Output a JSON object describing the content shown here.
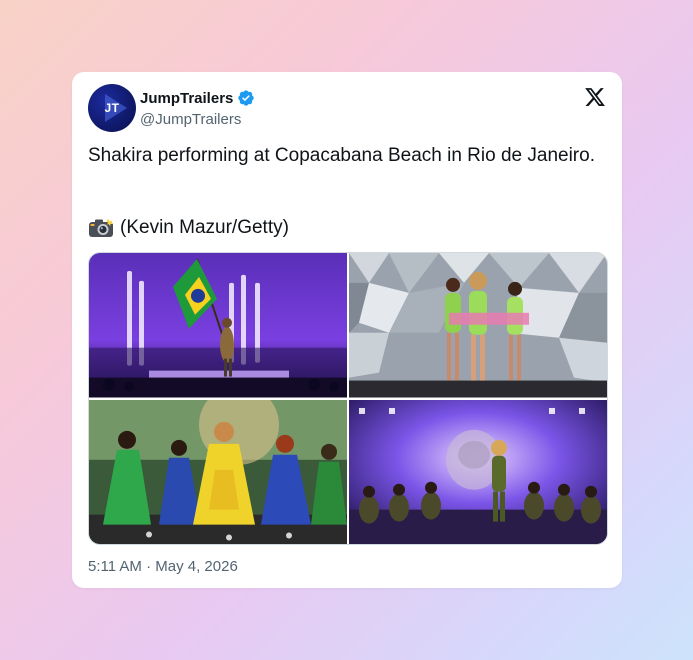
{
  "author": {
    "initials": "JT",
    "name": "JumpTrailers",
    "handle": "@JumpTrailers",
    "verified": true,
    "verified_color": "#1d9bf0"
  },
  "post": {
    "text": "Shakira performing at Copacabana Beach in Rio de Janeiro.",
    "credit_icon": "camera-icon",
    "credit": "(Kevin Mazur/Getty)",
    "timestamp": "5:11 AM · May 4, 2026"
  },
  "media": {
    "photos": [
      {
        "subject": "stage-flag-photo"
      },
      {
        "subject": "mirror-stage-photo"
      },
      {
        "subject": "dancers-photo"
      },
      {
        "subject": "tiger-stage-photo"
      }
    ]
  },
  "icons": {
    "platform": "x-logo-icon"
  }
}
